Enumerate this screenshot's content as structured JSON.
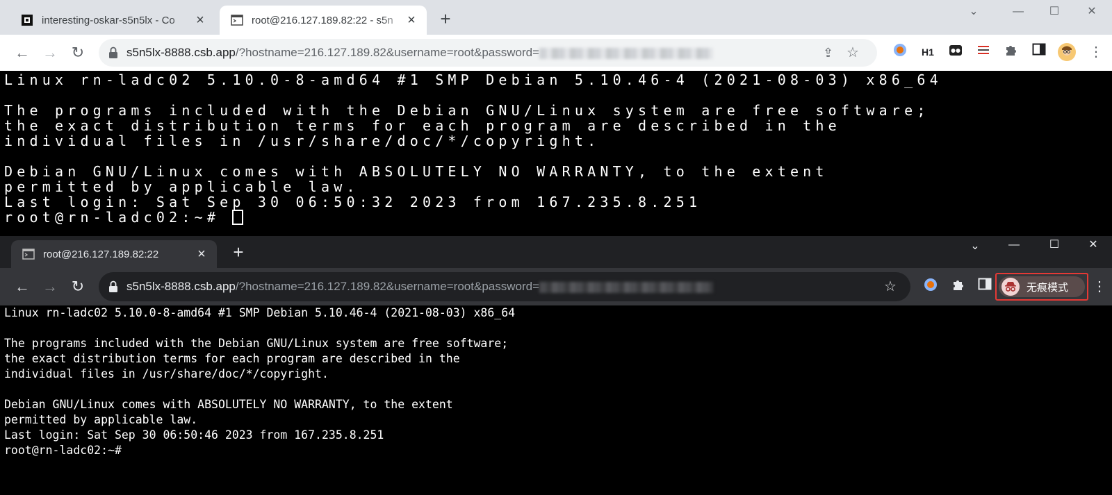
{
  "window1": {
    "tabs": [
      {
        "label": "interesting-oskar-s5n5lx - Co",
        "favicon": "codesandbox-icon",
        "active": false
      },
      {
        "label": "root@216.127.189.82:22 - s5n",
        "favicon": "terminal-icon",
        "active": true
      }
    ],
    "url": {
      "host": "s5n5lx-8888.csb.app",
      "path": "/?hostname=216.127.189.82&username=root&password="
    },
    "terminal": {
      "lines": [
        "Linux rn-ladc02 5.10.0-8-amd64 #1 SMP Debian 5.10.46-4 (2021-08-03) x86_64",
        "",
        "The programs included with the Debian GNU/Linux system are free software;",
        "the exact distribution terms for each program are described in the",
        "individual files in /usr/share/doc/*/copyright.",
        "",
        "Debian GNU/Linux comes with ABSOLUTELY NO WARRANTY, to the extent",
        "permitted by applicable law.",
        "Last login: Sat Sep 30 06:50:32 2023 from 167.235.8.251"
      ],
      "prompt": "root@rn-ladc02:~# "
    }
  },
  "window2": {
    "tabs": [
      {
        "label": "root@216.127.189.82:22",
        "favicon": "terminal-icon",
        "active": true
      }
    ],
    "url": {
      "host": "s5n5lx-8888.csb.app",
      "path": "/?hostname=216.127.189.82&username=root&password="
    },
    "incognito_label": "无痕模式",
    "terminal": {
      "lines": [
        "Linux rn-ladc02 5.10.0-8-amd64 #1 SMP Debian 5.10.46-4 (2021-08-03) x86_64",
        "",
        "The programs included with the Debian GNU/Linux system are free software;",
        "the exact distribution terms for each program are described in the",
        "individual files in /usr/share/doc/*/copyright.",
        "",
        "Debian GNU/Linux comes with ABSOLUTELY NO WARRANTY, to the extent",
        "permitted by applicable law.",
        "Last login: Sat Sep 30 06:50:46 2023 from 167.235.8.251"
      ],
      "prompt": "root@rn-ladc02:~#"
    }
  },
  "toolbar_extensions": [
    "record-extension-icon",
    "h1-extension-icon",
    "incognito-glasses-extension-icon",
    "sliders-extension-icon",
    "puzzle-icon",
    "side-panel-icon",
    "profile-avatar"
  ],
  "colors": {
    "incognito_highlight": "#e53935",
    "terminal_bg": "#000000",
    "terminal_fg": "#ffffff"
  }
}
